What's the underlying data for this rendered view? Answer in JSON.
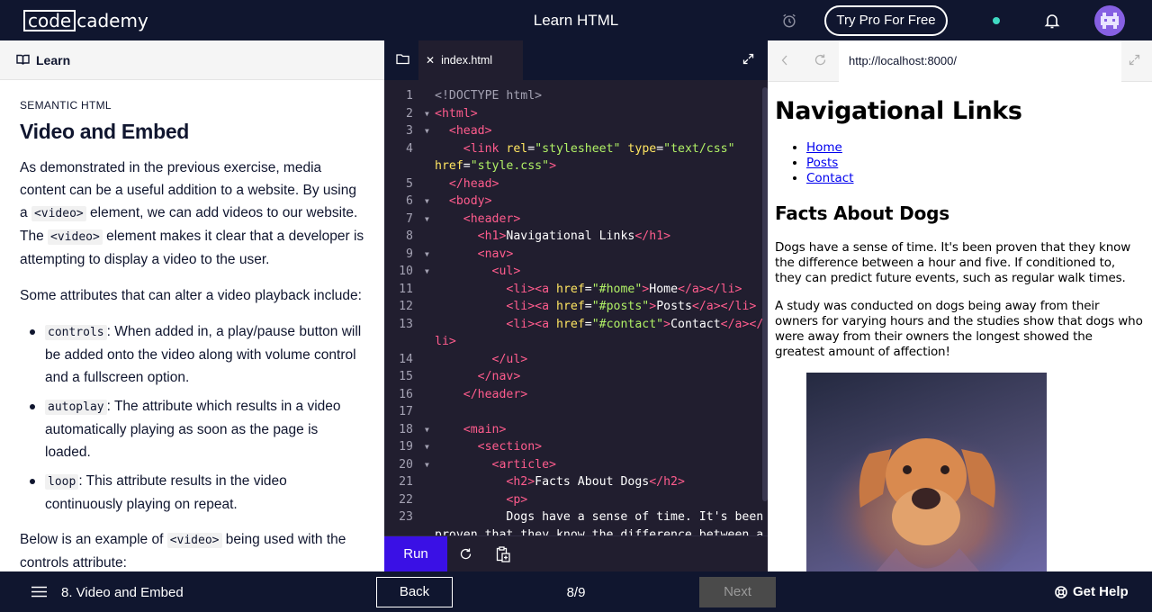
{
  "topbar": {
    "logo_box": "code",
    "logo_rest": "cademy",
    "title": "Learn HTML",
    "pro_button": "Try Pro For Free"
  },
  "left": {
    "tab_label": "Learn",
    "eyebrow": "SEMANTIC HTML",
    "heading": "Video and Embed",
    "p1": {
      "t1": "As demonstrated in the previous exercise, media content can be a useful addition to a website. By using a ",
      "c1": "<video>",
      "t2": " element, we can add videos to our website. The ",
      "c2": "<video>",
      "t3": " element makes it clear that a developer is attempting to display a video to the user."
    },
    "p2": "Some attributes that can alter a video playback include:",
    "bullets": [
      {
        "code": "controls",
        "text": ": When added in, a play/pause button will be added onto the video along with volume control and a fullscreen option."
      },
      {
        "code": "autoplay",
        "text": ": The attribute which results in a video automatically playing as soon as the page is loaded."
      },
      {
        "code": "loop",
        "text": ": This attribute results in the video continuously playing on repeat."
      }
    ],
    "p3": {
      "t1": "Below is an example of ",
      "c1": "<video>",
      "t2": " being used with the controls attribute:"
    }
  },
  "editor": {
    "file_tab": "index.html",
    "run_label": "Run"
  },
  "browser": {
    "url": "http://localhost:8000/",
    "h1": "Navigational Links",
    "links": [
      "Home",
      "Posts",
      "Contact"
    ],
    "h2": "Facts About Dogs",
    "p1": "Dogs have a sense of time. It's been proven that they know the difference between a hour and five. If conditioned to, they can predict future events, such as regular walk times.",
    "p2": "A study was conducted on dogs being away from their owners for varying hours and the studies show that dogs who were away from their owners the longest showed the greatest amount of affection!"
  },
  "footer": {
    "lesson": "8. Video and Embed",
    "back": "Back",
    "progress": "8/9",
    "next": "Next",
    "help": "Get Help"
  },
  "colors": {
    "navy": "#10162f",
    "editor_bg": "#211e2f",
    "run_blue": "#3a10e5",
    "tag_pink": "#ff5c8d",
    "attr_yellow": "#ffe561",
    "string_green": "#b0f065"
  }
}
